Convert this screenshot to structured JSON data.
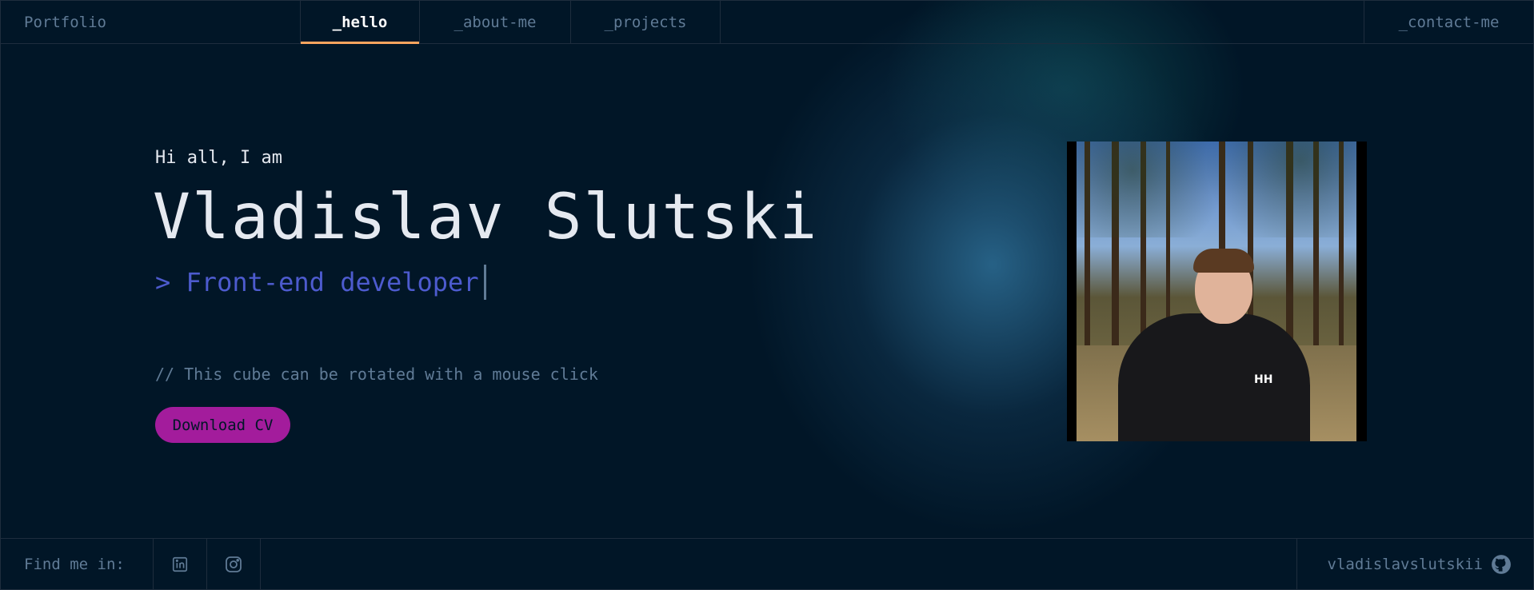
{
  "header": {
    "brand": "Portfolio",
    "tabs": [
      {
        "label": "_hello",
        "active": true
      },
      {
        "label": "_about-me",
        "active": false
      },
      {
        "label": "_projects",
        "active": false
      }
    ],
    "contact": "_contact-me"
  },
  "hero": {
    "greeting": "Hi all, I am",
    "name": "Vladislav Slutski",
    "role": "> Front-end developer",
    "comment": "// This cube can be rotated with a mouse click",
    "cv_button": "Download CV"
  },
  "photo": {
    "description_icon": "portrait-photo",
    "jacket_logo": "HH"
  },
  "footer": {
    "find_me": "Find me in:",
    "socials": [
      {
        "icon": "linkedin-icon"
      },
      {
        "icon": "instagram-icon"
      }
    ],
    "github_user": "vladislavslutskii",
    "github_icon": "github-icon"
  },
  "colors": {
    "background": "#011627",
    "border": "#1e2d3d",
    "accent_tab": "#fea55f",
    "text_muted": "#607b96",
    "role": "#4d5bce",
    "button": "#a31c9c"
  }
}
